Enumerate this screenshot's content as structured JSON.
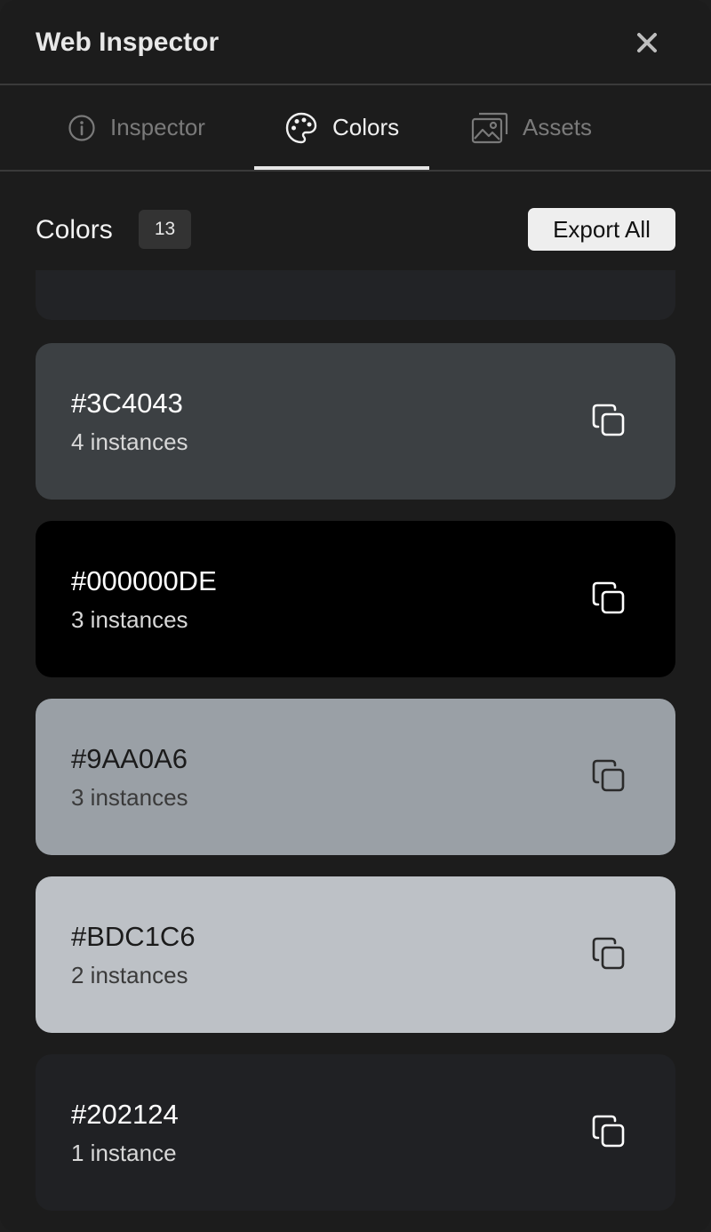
{
  "header": {
    "title": "Web Inspector",
    "close_icon": "close-icon"
  },
  "tabs": [
    {
      "label": "Inspector",
      "icon": "info-icon",
      "active": false
    },
    {
      "label": "Colors",
      "icon": "palette-icon",
      "active": true
    },
    {
      "label": "Assets",
      "icon": "image-icon",
      "active": false
    }
  ],
  "section": {
    "title": "Colors",
    "count": "13",
    "export_label": "Export All"
  },
  "colors": [
    {
      "hex": "#3C4043",
      "instances": "4 instances",
      "swatch": "#3c4043"
    },
    {
      "hex": "#000000DE",
      "instances": "3 instances",
      "swatch": "#000000"
    },
    {
      "hex": "#9AA0A6",
      "instances": "3 instances",
      "swatch": "#9aa0a6"
    },
    {
      "hex": "#BDC1C6",
      "instances": "2 instances",
      "swatch": "#bdc1c6"
    },
    {
      "hex": "#202124",
      "instances": "1 instance",
      "swatch": "#202124"
    }
  ],
  "theme": {
    "background": "#1c1c1c",
    "active_tab": "#f0f0f0",
    "inactive_tab": "#7a7a7a"
  }
}
